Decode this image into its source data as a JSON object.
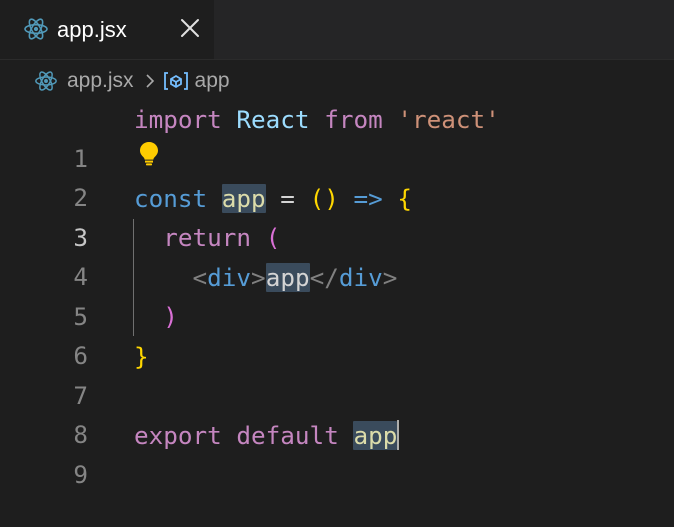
{
  "tab": {
    "label": "app.jsx",
    "icon": "react-icon",
    "close_icon": "close-icon"
  },
  "breadcrumb": {
    "file": "app.jsx",
    "symbol": "app"
  },
  "editor": {
    "active_line": 3,
    "line_numbers": [
      "1",
      "2",
      "3",
      "4",
      "5",
      "6",
      "7",
      "8",
      "9"
    ],
    "tokens": {
      "l1_import": "import",
      "l1_react": "React",
      "l1_from": "from",
      "l1_str": "'react'",
      "l3_const": "const",
      "l3_app": "app",
      "l3_eq": " = ",
      "l3_parens": "()",
      "l3_arrow": " => ",
      "l3_brace": "{",
      "l4_return": "return",
      "l4_paren": "(",
      "l5_open_lt": "<",
      "l5_open_tag": "div",
      "l5_open_gt": ">",
      "l5_text": "app",
      "l5_close_lt": "</",
      "l5_close_tag": "div",
      "l5_close_gt": ">",
      "l6_paren": ")",
      "l7_brace": "}",
      "l9_export": "export",
      "l9_default": "default",
      "l9_app": "app"
    },
    "lightbulb_icon": "lightbulb-icon"
  },
  "colors": {
    "background": "#1e1e1e",
    "tabbar": "#252526",
    "keyword_purple": "#c586c0",
    "keyword_blue": "#569cd6",
    "string": "#ce9178",
    "type": "#4ec9b0",
    "bracket_gold": "#ffd700",
    "bracket_pink": "#da70d6",
    "highlight": "#3a4b5c",
    "react_icon": "#519aba"
  }
}
